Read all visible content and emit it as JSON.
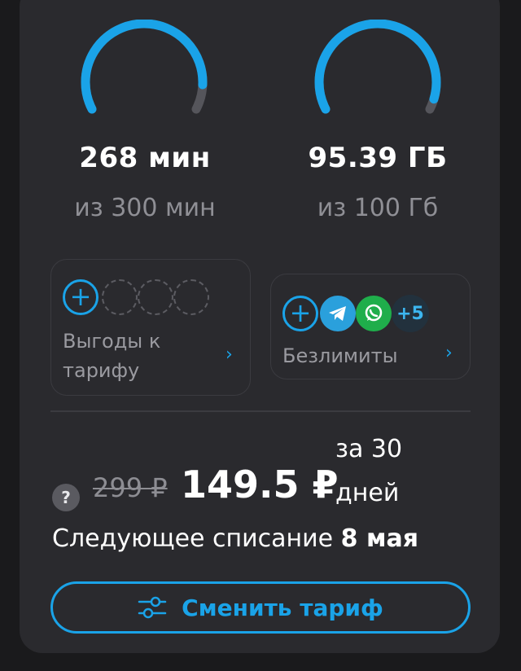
{
  "colors": {
    "accent": "#1aa3e8",
    "card_bg": "#2a2a2e",
    "page_bg": "#1a1a1c",
    "muted_text": "#8f8f95",
    "gauge_track": "#55555b"
  },
  "minutes": {
    "remaining_label": "268 мин",
    "total_label": "из 300 мин",
    "remaining_fraction": 0.893
  },
  "data_usage": {
    "remaining_label": "95.39 ГБ",
    "total_label": "из 100 Гб",
    "remaining_fraction": 0.954
  },
  "benefits_tile": {
    "label_line1": "Выгоды к",
    "label_line2": "тарифу",
    "add_icon": "plus-icon",
    "empty_slots": 3,
    "chevron": "›"
  },
  "unlimited_tile": {
    "label": "Безлимиты",
    "add_icon": "plus-icon",
    "apps": [
      "telegram-icon",
      "whatsapp-icon"
    ],
    "more_label": "+5",
    "chevron": "›"
  },
  "pricing": {
    "help_glyph": "?",
    "old_price": "299 ₽",
    "new_price": "149.5 ₽",
    "period_line1": "за 30",
    "period_line2": "дней"
  },
  "next_charge": {
    "prefix": "Следующее списание ",
    "date": "8 мая"
  },
  "change_plan_button": {
    "label": "Сменить тариф",
    "icon": "sliders-icon"
  }
}
